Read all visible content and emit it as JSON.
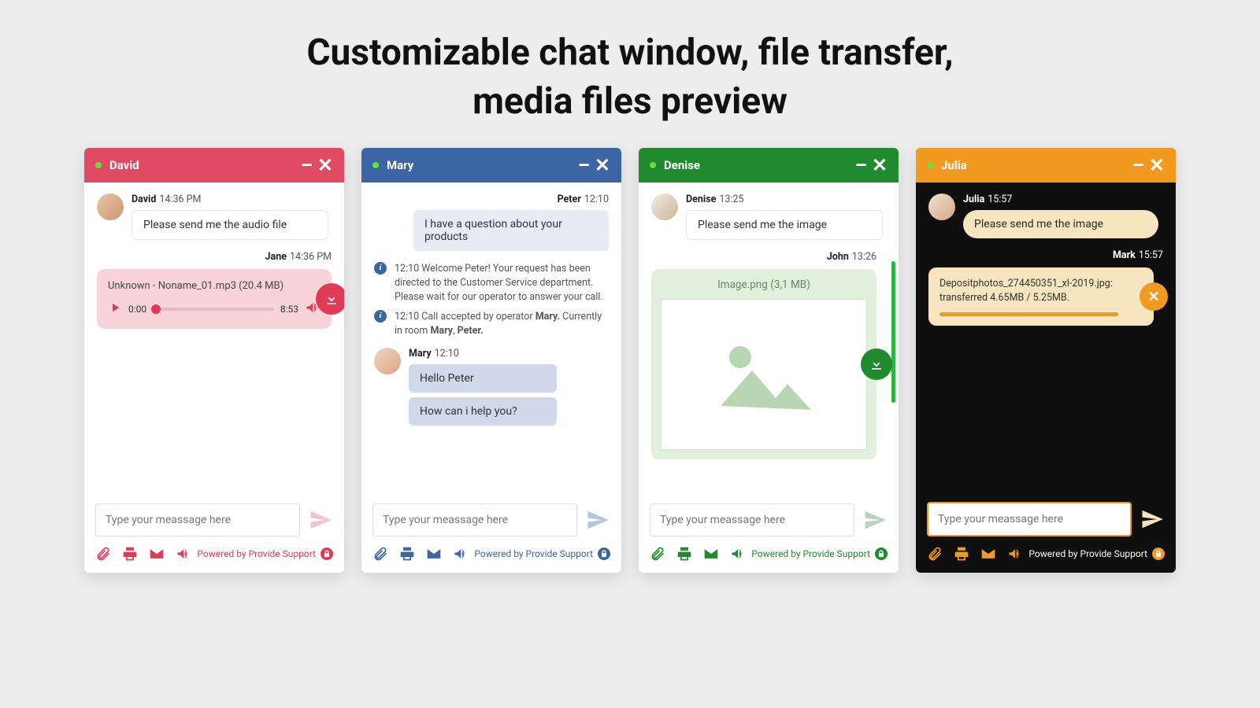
{
  "title_line1": "Customizable chat window, file transfer,",
  "title_line2": "media files preview",
  "common": {
    "input_placeholder": "Type your meassage here",
    "powered": "Powered by Provide Support"
  },
  "w1": {
    "name": "David",
    "m1_name": "David",
    "m1_time": "14:36 PM",
    "m1_text": "Please send me the audio file",
    "m2_name": "Jane",
    "m2_time": "14:36 PM",
    "audio_label": "Unknown - Noname_01.mp3 (20.4 MB)",
    "audio_cur": "0:00",
    "audio_dur": "8:53"
  },
  "w2": {
    "name": "Mary",
    "p_name": "Peter",
    "p_time": "12:10",
    "p_text": "I have a question about your products",
    "sys1_time": "12:10",
    "sys1_text": "Welcome Peter! Your request has been directed to the Customer Service department. Please wait for our operator to answer your call.",
    "sys2_time": "12:10",
    "sys2_text_a": "Call accepted by operator ",
    "sys2_b1": "Mary.",
    "sys2_text_b": " Currently in room ",
    "sys2_b2": "Mary",
    "sys2_sep": ", ",
    "sys2_b3": "Peter.",
    "op_name": "Mary",
    "op_time": "12:10",
    "op_msg1": "Hello Peter",
    "op_msg2": "How can i help you?"
  },
  "w3": {
    "name": "Denise",
    "m1_name": "Denise",
    "m1_time": "13:25",
    "m1_text": "Please send me the image",
    "m2_name": "John",
    "m2_time": "13:26",
    "img_label": "Image.png (3,1 MB)"
  },
  "w4": {
    "name": "Julia",
    "m1_name": "Julia",
    "m1_time": "15:57",
    "m1_text": "Please send me the image",
    "m2_name": "Mark",
    "m2_time": "15:57",
    "up_line1": "Depositphotos_274450351_xl-2019.jpg:",
    "up_line2": "transferred 4.65MB / 5.25MB."
  }
}
